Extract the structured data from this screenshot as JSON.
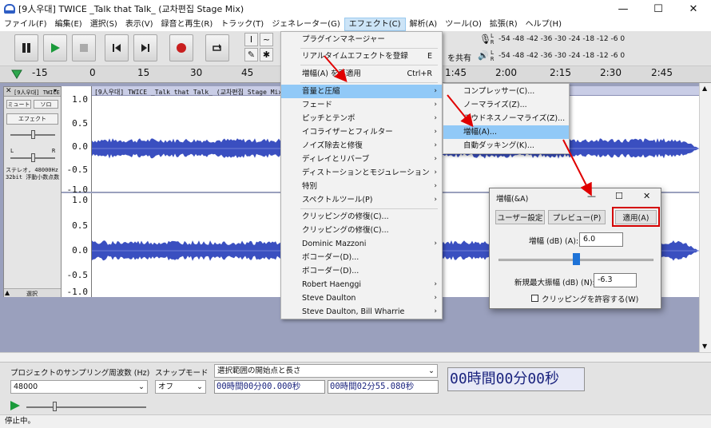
{
  "window": {
    "title": "[9人우대] TWICE _Talk that Talk_ (교차편집 Stage Mix)",
    "minimize": "—",
    "maximize": "☐",
    "close": "✕"
  },
  "menubar": [
    {
      "label": "ファイル(F)"
    },
    {
      "label": "編集(E)"
    },
    {
      "label": "選択(S)"
    },
    {
      "label": "表示(V)"
    },
    {
      "label": "録音と再生(R)"
    },
    {
      "label": "トラック(T)"
    },
    {
      "label": "ジェネレーター(G)"
    },
    {
      "label": "エフェクト(C)"
    },
    {
      "label": "解析(A)"
    },
    {
      "label": "ツール(O)"
    },
    {
      "label": "拡張(R)"
    },
    {
      "label": "ヘルプ(H)"
    }
  ],
  "toolbar": {
    "meter_scale": "-54 -48 -42 -36 -30 -24 -18 -12 -6 0",
    "meter_left_label": "L",
    "meter_right_label": "R",
    "sharing_label": "を共有"
  },
  "ruler": {
    "ticks": [
      "-15",
      "0",
      "15",
      "30",
      "45",
      "1:45",
      "2:00",
      "2:15",
      "2:30",
      "2:45"
    ]
  },
  "track": {
    "name": "[9人우대] TWICE",
    "clip_title": "[9人우대] TWICE _Talk that Talk_ (교차편집 Stage Mix)",
    "mute": "ミュート",
    "solo": "ソロ",
    "effects": "エフェクト",
    "gain_left": "L",
    "gain_right": "R",
    "info_line1": "ステレオ, 48000Hz",
    "info_line2": "32bit 浮動小数点数",
    "select_label": "選択",
    "scale_top": [
      "1.0",
      "0.5",
      "0.0",
      "-0.5",
      "-1.0"
    ],
    "scale_bottom": [
      "1.0",
      "0.5",
      "0.0",
      "-0.5",
      "-1.0"
    ]
  },
  "effect_menu": {
    "items": [
      {
        "label": "プラグインマネージャー",
        "accel": "",
        "arrow": false
      },
      {
        "label": "リアルタイムエフェクトを登録",
        "accel": "E",
        "arrow": false
      },
      {
        "label": "増幅(A) を再適用",
        "accel": "Ctrl+R",
        "arrow": false
      },
      {
        "label": "音量と圧縮",
        "accel": "",
        "arrow": true
      },
      {
        "label": "フェード",
        "accel": "",
        "arrow": true
      },
      {
        "label": "ピッチとテンポ",
        "accel": "",
        "arrow": true
      },
      {
        "label": "イコライザーとフィルター",
        "accel": "",
        "arrow": true
      },
      {
        "label": "ノイズ除去と修復",
        "accel": "",
        "arrow": true
      },
      {
        "label": "ディレイとリバーブ",
        "accel": "",
        "arrow": true
      },
      {
        "label": "ディストーションとモジュレーション",
        "accel": "",
        "arrow": true
      },
      {
        "label": "特別",
        "accel": "",
        "arrow": true
      },
      {
        "label": "スペクトルツール(P)",
        "accel": "",
        "arrow": true
      },
      {
        "label": "クリッピングの修復(C)...",
        "accel": "",
        "arrow": false
      },
      {
        "label": "クリッピングの修復(C)...",
        "accel": "",
        "arrow": false
      },
      {
        "label": "Dominic Mazzoni",
        "accel": "",
        "arrow": true
      },
      {
        "label": "ボコーダー(D)...",
        "accel": "",
        "arrow": false
      },
      {
        "label": "ボコーダー(D)...",
        "accel": "",
        "arrow": false
      },
      {
        "label": "Robert Haenggi",
        "accel": "",
        "arrow": true
      },
      {
        "label": "Steve Daulton",
        "accel": "",
        "arrow": true
      },
      {
        "label": "Steve Daulton, Bill Wharrie",
        "accel": "",
        "arrow": true
      }
    ],
    "arrow_glyph": "›"
  },
  "submenu": {
    "items": [
      {
        "label": "コンプレッサー(C)..."
      },
      {
        "label": "ノーマライズ(Z)..."
      },
      {
        "label": "ラウドネスノーマライズ(Z)..."
      },
      {
        "label": "増幅(A)..."
      },
      {
        "label": "自動ダッキング(K)..."
      }
    ]
  },
  "dialog": {
    "title": "増幅(&A)",
    "minimize": "—",
    "maximize": "☐",
    "close": "✕",
    "user_preset": "ユーザー設定",
    "preview": "プレビュー(P)",
    "apply": "適用(A)",
    "amp_label": "増幅 (dB) (A):",
    "amp_value": "6.0",
    "amp_slider": 0.5,
    "peak_label": "新規最大振幅 (dB) (N):",
    "peak_value": "-6.3",
    "clip_label": "クリッピングを許容する(W)",
    "clip_checked": false
  },
  "selection_toolbar": {
    "rate_label": "プロジェクトのサンプリング周波数 (Hz)",
    "rate_value": "48000",
    "snap_label": "スナップモード",
    "snap_value": "オフ",
    "range_mode": "選択範囲の開始点と長さ",
    "start_time": "00時間00分00.000秒",
    "length_time": "00時間02分55.080秒",
    "audio_position": "00時間00分00秒"
  },
  "status": {
    "text": "停止中。"
  },
  "colors": {
    "accent": "#91c9f7",
    "highlight_box": "#d40000",
    "waveform": "#3a4fc0"
  }
}
